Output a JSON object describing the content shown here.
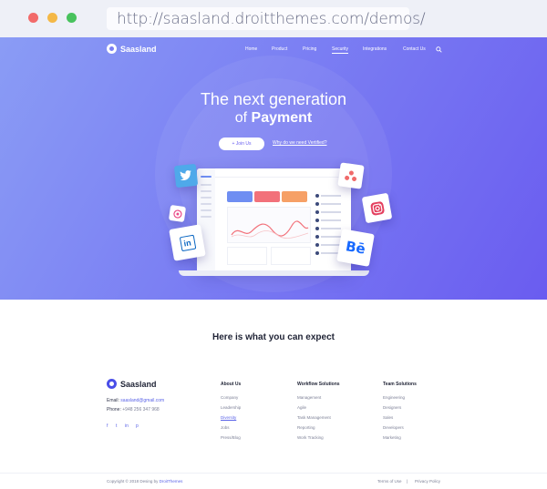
{
  "browser": {
    "url": "http://saasland.droitthemes.com/demos/"
  },
  "header": {
    "brand": "Saasland",
    "nav": [
      "Home",
      "Product",
      "Pricing",
      "Security",
      "Integrations",
      "Contact Us"
    ],
    "active_nav": "Security"
  },
  "hero": {
    "line1": "The next generation",
    "line2_prefix": "of",
    "line2_bold": "Payment",
    "join_button": "+ Join Us",
    "why_link": "Why do we need Vertified?"
  },
  "social_tiles": [
    "twitter-icon",
    "dribbble-icon",
    "linkedin-icon",
    "asana-icon",
    "instagram-icon",
    "behance-icon"
  ],
  "social_tile_labels": {
    "linkedin": "in",
    "behance": "Bē"
  },
  "section": {
    "expect_title": "Here is what you can expect"
  },
  "footer": {
    "brand": "Saasland",
    "email_label": "Email:",
    "email_value": "saasland@gmail.com",
    "phone_label": "Phone:",
    "phone_value": "+948 256 347 968",
    "social": [
      "f",
      "t",
      "in",
      "p"
    ],
    "columns": [
      {
        "title": "About Us",
        "links": [
          "Company",
          "Leadership",
          "Diversity",
          "Jobs",
          "Press/Blog"
        ],
        "active": "Diversity"
      },
      {
        "title": "Workflow Solutions",
        "links": [
          "Management",
          "Agile",
          "Task Management",
          "Reporting",
          "Work Tracking"
        ]
      },
      {
        "title": "Team Solutions",
        "links": [
          "Engineering",
          "Designers",
          "Sales",
          "Developers",
          "Marketing"
        ]
      }
    ],
    "copyright_prefix": "Copyright © 2018 Desing by",
    "copyright_brand": "DroitThemes",
    "terms": "Terms of Use",
    "separator": "|",
    "privacy": "Privacy Policy"
  },
  "colors": {
    "accent": "#5a63e8",
    "hero_start": "#8a9cf5",
    "hero_end": "#6a5cf0"
  }
}
